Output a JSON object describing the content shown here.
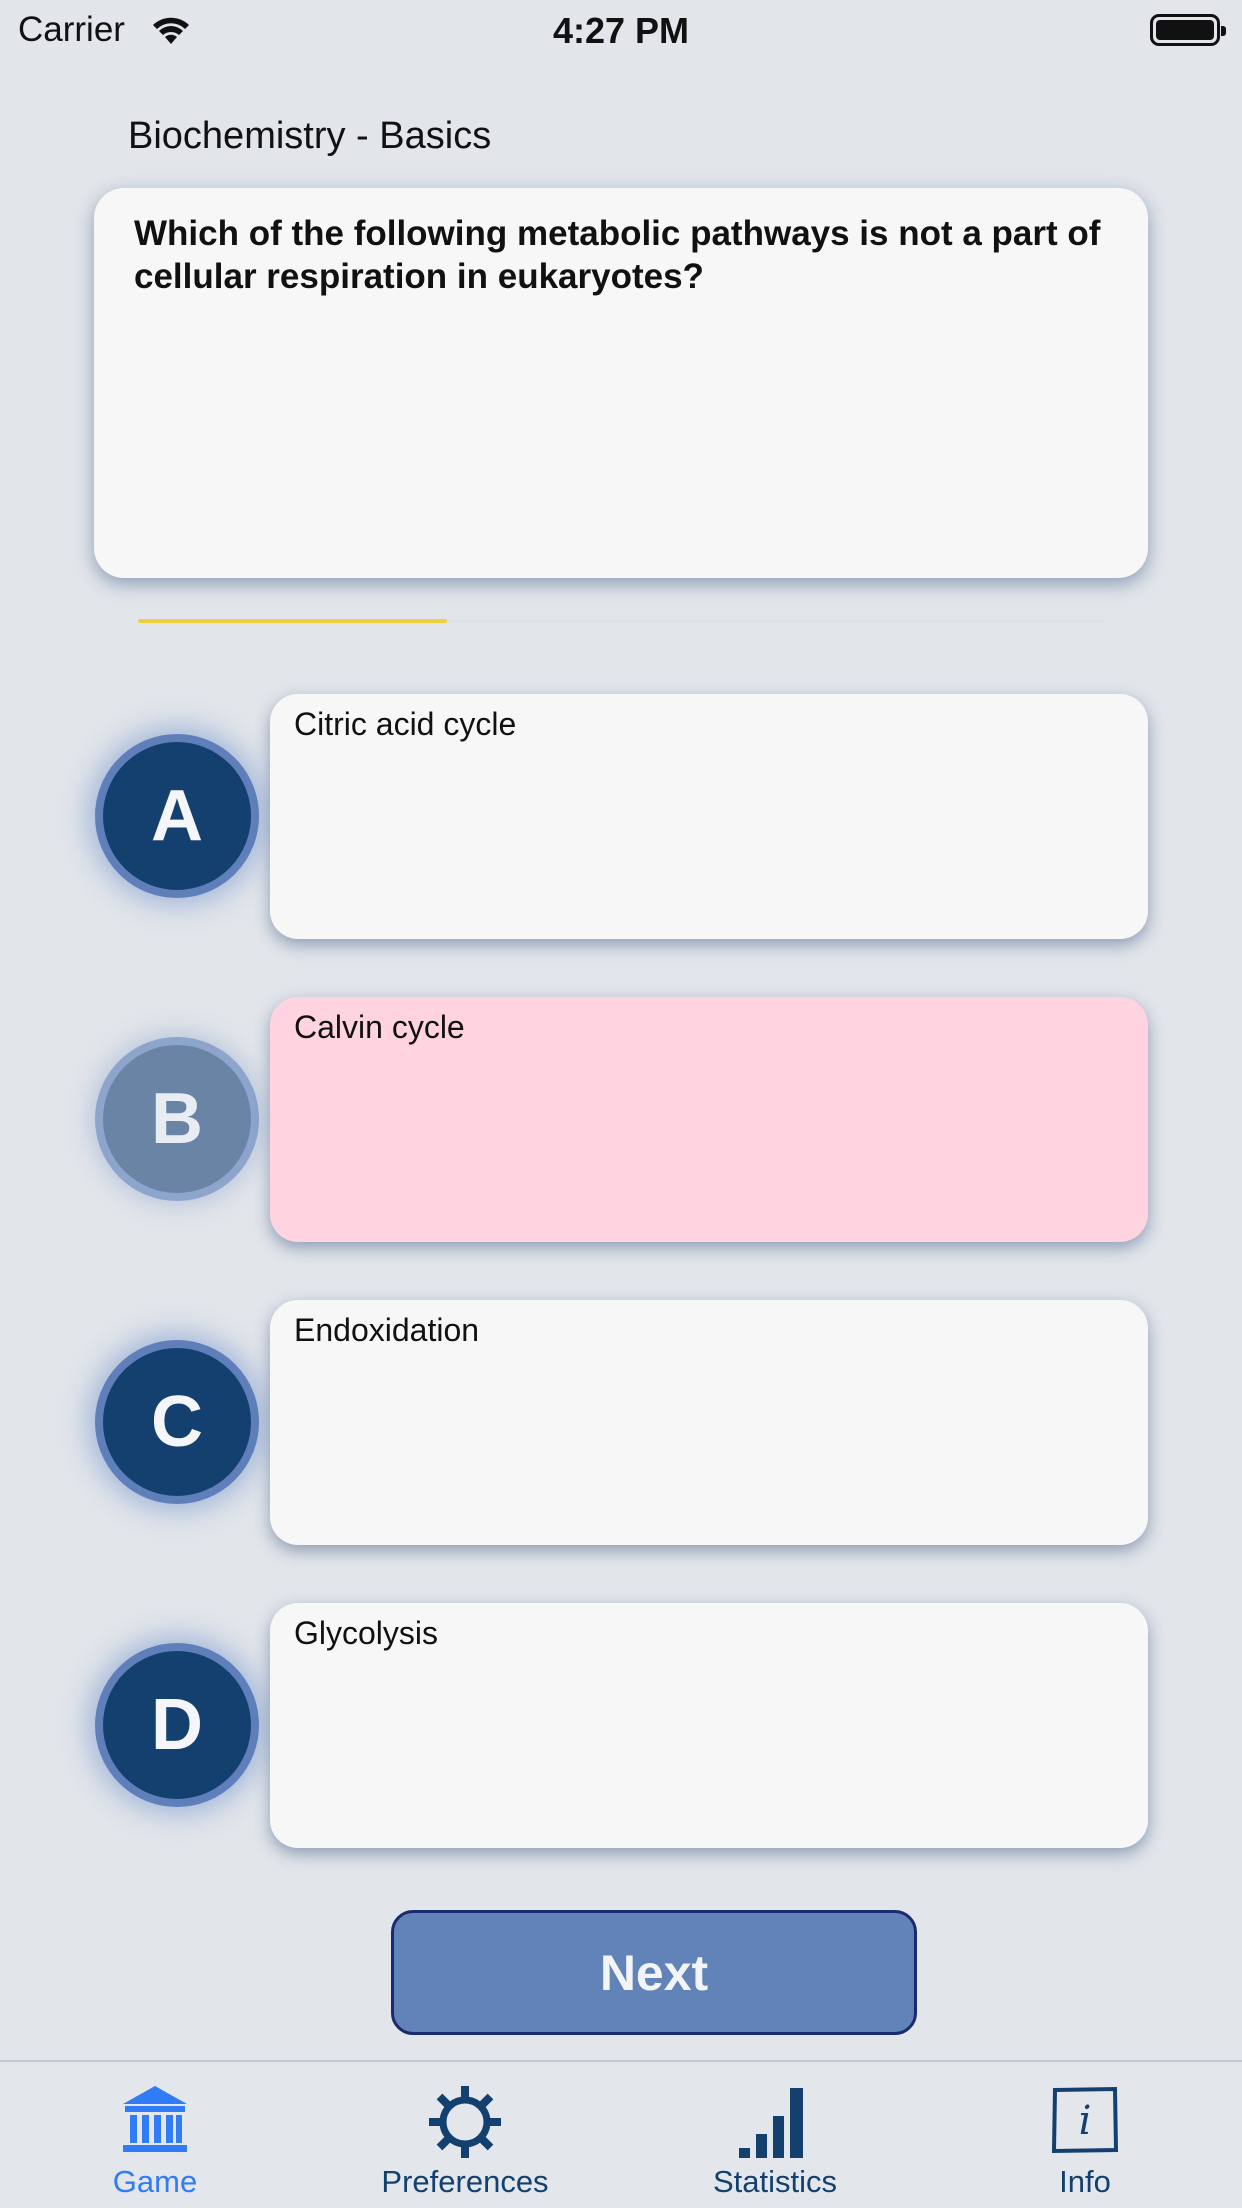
{
  "status_bar": {
    "carrier": "Carrier",
    "time": "4:27 PM"
  },
  "category": "Biochemistry - Basics",
  "question": "Which of the following metabolic pathways is not a part of cellular respiration in eukaryotes?",
  "timer_progress": 0.32,
  "answers": [
    {
      "letter": "A",
      "text": "Citric acid cycle",
      "state": "normal"
    },
    {
      "letter": "B",
      "text": "Calvin cycle",
      "state": "selected-wrong"
    },
    {
      "letter": "C",
      "text": "Endoxidation",
      "state": "normal"
    },
    {
      "letter": "D",
      "text": "Glycolysis",
      "state": "normal"
    }
  ],
  "next_label": "Next",
  "tabs": [
    {
      "label": "Game",
      "icon": "bank-icon",
      "active": true
    },
    {
      "label": "Preferences",
      "icon": "gear-icon",
      "active": false
    },
    {
      "label": "Statistics",
      "icon": "bar-chart-icon",
      "active": false
    },
    {
      "label": "Info",
      "icon": "info-icon",
      "active": false
    }
  ],
  "colors": {
    "accent_active_tab": "#2f7cf6",
    "navy": "#14406f",
    "wrong_answer_bg": "#ffd3df",
    "timer_bar": "#f1cf3a",
    "next_button": "#6283b7"
  }
}
